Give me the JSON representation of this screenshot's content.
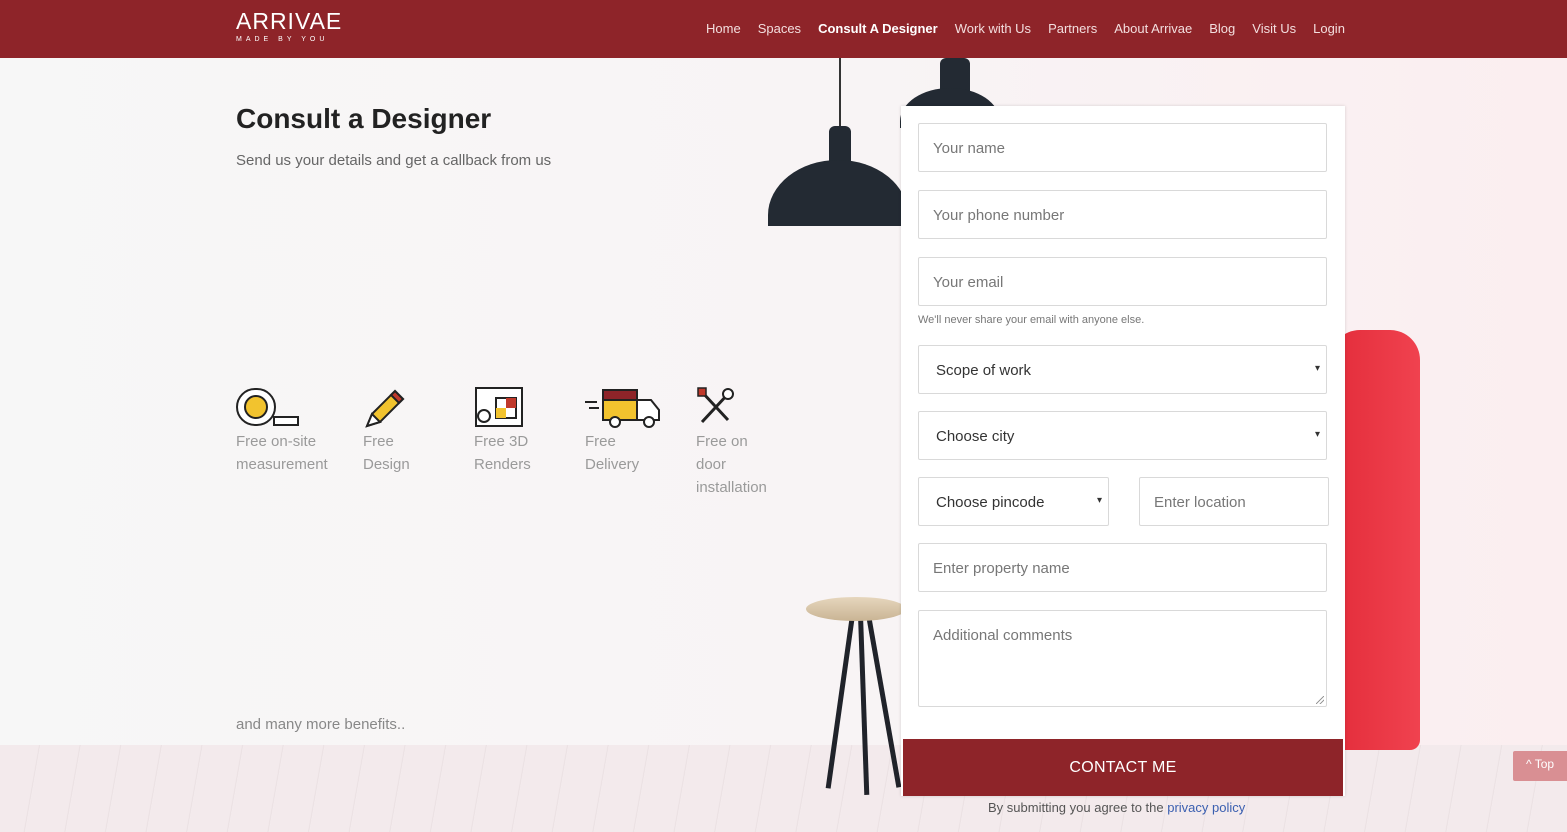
{
  "brand": {
    "name": "ARRIVAE",
    "tagline": "MADE BY YOU"
  },
  "nav": {
    "items": [
      {
        "label": "Home"
      },
      {
        "label": "Spaces"
      },
      {
        "label": "Consult A Designer"
      },
      {
        "label": "Work with Us"
      },
      {
        "label": "Partners"
      },
      {
        "label": "About Arrivae"
      },
      {
        "label": "Blog"
      },
      {
        "label": "Visit Us"
      },
      {
        "label": "Login"
      }
    ],
    "active": "Consult A Designer"
  },
  "hero": {
    "title": "Consult a Designer",
    "subtitle": "Send us your details and get a callback from us",
    "more": "and many more benefits.."
  },
  "features": [
    {
      "label": "Free on-site measurement",
      "icon": "tape-measure-icon"
    },
    {
      "label": "Free Design",
      "icon": "pencil-icon"
    },
    {
      "label": "Free 3D Renders",
      "icon": "blueprint-icon"
    },
    {
      "label": "Free Delivery",
      "icon": "delivery-truck-icon"
    },
    {
      "label": "Free on door installation",
      "icon": "tools-icon"
    }
  ],
  "form": {
    "name_placeholder": "Your name",
    "phone_placeholder": "Your phone number",
    "email_placeholder": "Your email",
    "email_help": "We'll never share your email with anyone else.",
    "scope_select": "Scope of work",
    "city_select": "Choose city",
    "pincode_select": "Choose pincode",
    "location_placeholder": "Enter location",
    "property_placeholder": "Enter property name",
    "comments_placeholder": "Additional comments",
    "submit_label": "CONTACT ME",
    "agree_text": "By submitting you agree to the",
    "privacy_link": "privacy policy"
  },
  "top_button": {
    "label": "Top"
  },
  "colors": {
    "brand": "#8e2429",
    "link": "#3a5fb0",
    "accent_yellow": "#f2c32e"
  }
}
